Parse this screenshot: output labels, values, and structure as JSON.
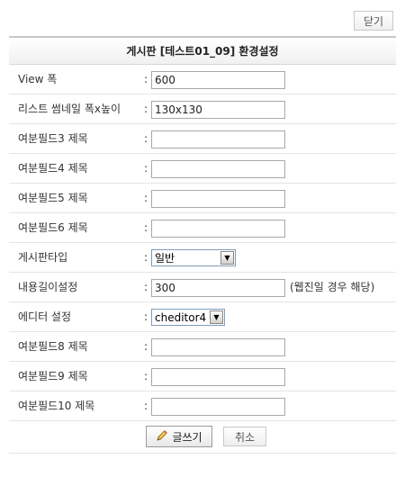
{
  "close_label": "닫기",
  "title": "게시판 [테스트01_09] 환경설정",
  "colon": ":",
  "fields": {
    "view_width": {
      "label": "View 폭",
      "value": "600"
    },
    "list_thumb": {
      "label": "리스트 썸네일 폭x높이",
      "value": "130x130"
    },
    "extra3": {
      "label": "여분필드3 제목",
      "value": ""
    },
    "extra4": {
      "label": "여분필드4 제목",
      "value": ""
    },
    "extra5": {
      "label": "여분필드5 제목",
      "value": ""
    },
    "extra6": {
      "label": "여분필드6 제목",
      "value": ""
    },
    "board_type": {
      "label": "게시판타입",
      "selected": "일반"
    },
    "content_length": {
      "label": "내용길이설정",
      "value": "300",
      "note": "(웹진일 경우 해당)"
    },
    "editor": {
      "label": "에디터 설정",
      "selected": "cheditor4"
    },
    "extra8": {
      "label": "여분필드8 제목",
      "value": ""
    },
    "extra9": {
      "label": "여분필드9 제목",
      "value": ""
    },
    "extra10": {
      "label": "여분필드10 제목",
      "value": ""
    }
  },
  "write_label": "글쓰기",
  "cancel_label": "취소",
  "icons": {
    "write": "pencil-icon",
    "dropdown": "chevron-down-icon"
  }
}
